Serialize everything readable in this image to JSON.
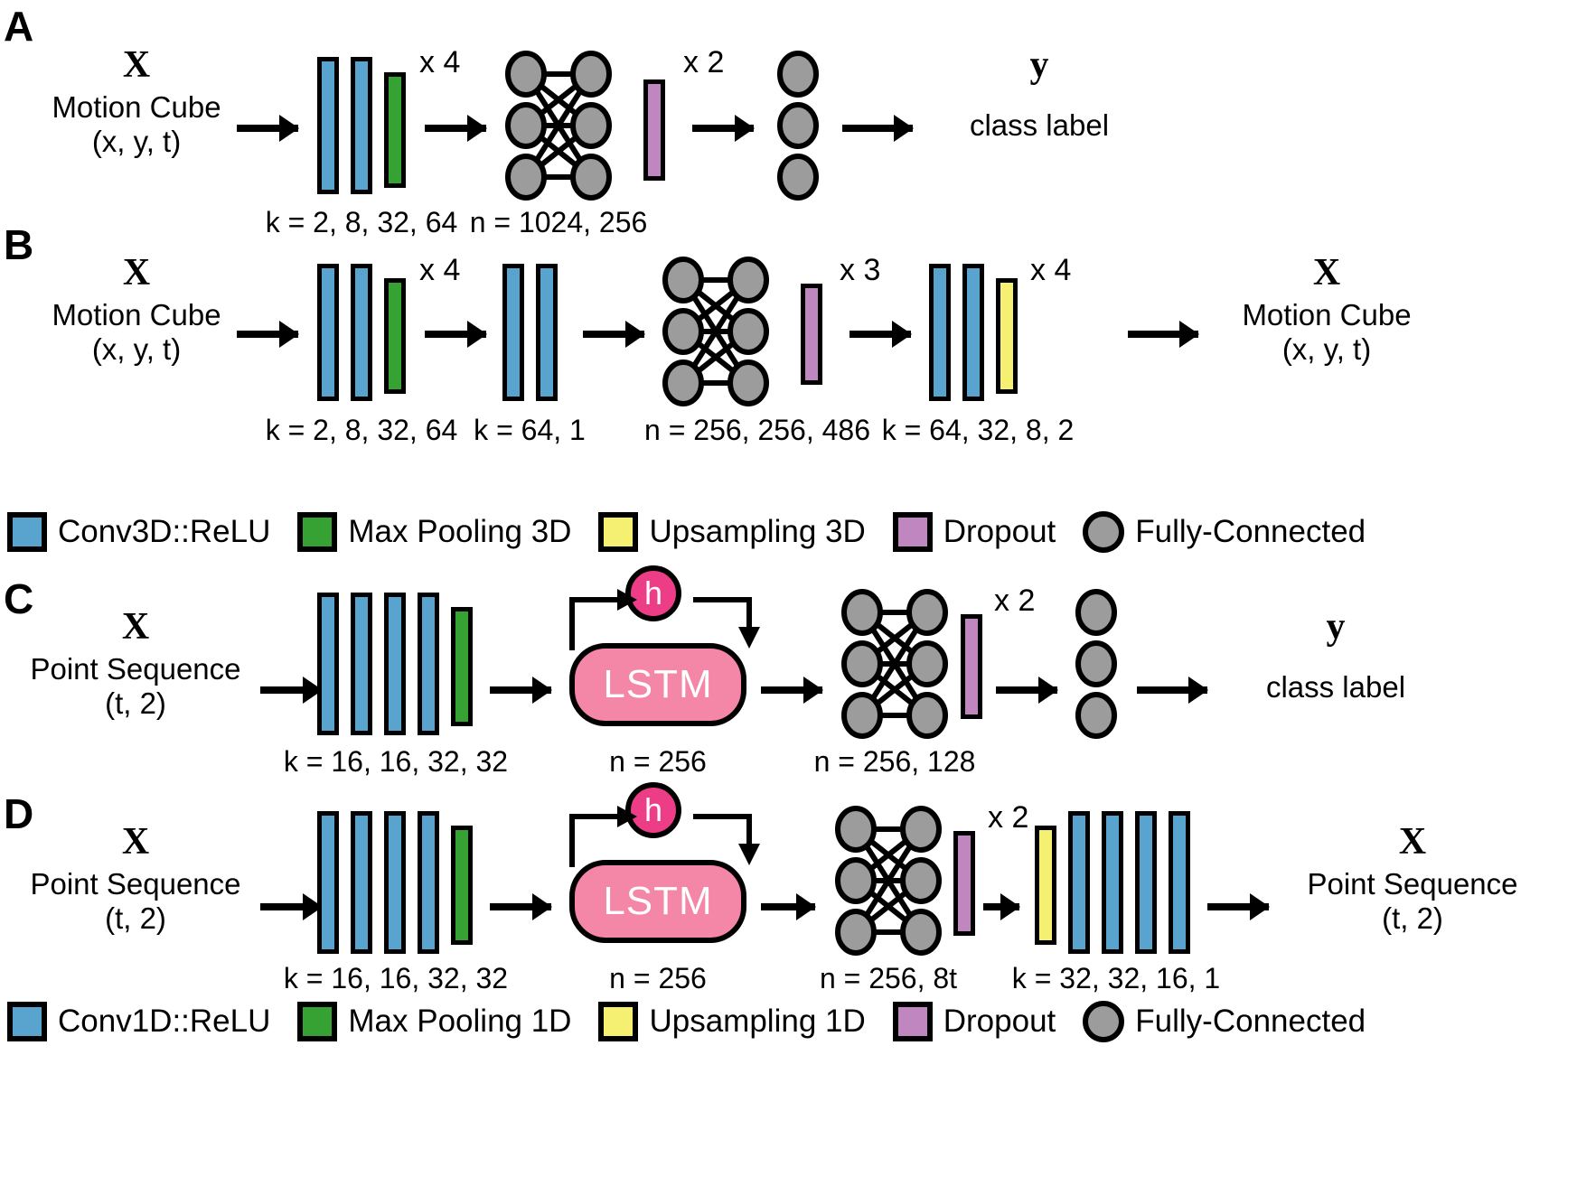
{
  "colors": {
    "conv": "#58a4ce",
    "pool": "#35a233",
    "upsample": "#f6f072",
    "dropout": "#bf86bf",
    "fully_connected": "#9c9c9c",
    "lstm_body": "#f486a8",
    "lstm_hidden": "#ee3d87",
    "stroke": "#000000",
    "background": "#ffffff"
  },
  "panels": [
    {
      "letter": "A",
      "input": {
        "symbol": "X",
        "lines": [
          "Motion Cube",
          "(x, y, t)"
        ]
      },
      "output": {
        "symbol": "y",
        "lines": [
          "class label"
        ]
      },
      "multipliers": [
        "x 4",
        "x 2"
      ],
      "params": [
        "k = 2, 8, 32, 64",
        "n = 1024, 256"
      ]
    },
    {
      "letter": "B",
      "input": {
        "symbol": "X",
        "lines": [
          "Motion Cube",
          "(x, y, t)"
        ]
      },
      "output": {
        "symbol": "X",
        "lines": [
          "Motion Cube",
          "(x, y, t)"
        ]
      },
      "multipliers": [
        "x 4",
        "x 3",
        "x 4"
      ],
      "params": [
        "k = 2, 8, 32, 64",
        "k = 64, 1",
        "n = 256, 256, 486",
        "k = 64, 32, 8, 2"
      ]
    },
    {
      "letter": "C",
      "input": {
        "symbol": "X",
        "lines": [
          "Point Sequence",
          "(t, 2)"
        ]
      },
      "output": {
        "symbol": "y",
        "lines": [
          "class label"
        ]
      },
      "multipliers": [
        "x 2"
      ],
      "params": [
        "k = 16, 16, 32, 32",
        "n = 256",
        "n = 256, 128"
      ],
      "lstm": {
        "body_label": "LSTM",
        "hidden_label": "h"
      }
    },
    {
      "letter": "D",
      "input": {
        "symbol": "X",
        "lines": [
          "Point Sequence",
          "(t, 2)"
        ]
      },
      "output": {
        "symbol": "X",
        "lines": [
          "Point Sequence",
          "(t, 2)"
        ]
      },
      "multipliers": [
        "x 2"
      ],
      "params": [
        "k = 16, 16, 32, 32",
        "n = 256",
        "n = 256, 8t",
        "k = 32, 32, 16, 1"
      ],
      "lstm": {
        "body_label": "LSTM",
        "hidden_label": "h"
      }
    }
  ],
  "legend_3d": [
    {
      "name": "conv3d",
      "label": "Conv3D::ReLU",
      "shape": "square"
    },
    {
      "name": "maxpool3d",
      "label": "Max Pooling 3D",
      "shape": "square"
    },
    {
      "name": "upsampling3d",
      "label": "Upsampling 3D",
      "shape": "square"
    },
    {
      "name": "dropout",
      "label": "Dropout",
      "shape": "square"
    },
    {
      "name": "fully-connected",
      "label": "Fully-Connected",
      "shape": "circle"
    }
  ],
  "legend_1d": [
    {
      "name": "conv1d",
      "label": "Conv1D::ReLU",
      "shape": "square"
    },
    {
      "name": "maxpool1d",
      "label": "Max Pooling 1D",
      "shape": "square"
    },
    {
      "name": "upsampling1d",
      "label": "Upsampling 1D",
      "shape": "square"
    },
    {
      "name": "dropout",
      "label": "Dropout",
      "shape": "square"
    },
    {
      "name": "fully-connected",
      "label": "Fully-Connected",
      "shape": "circle"
    }
  ]
}
